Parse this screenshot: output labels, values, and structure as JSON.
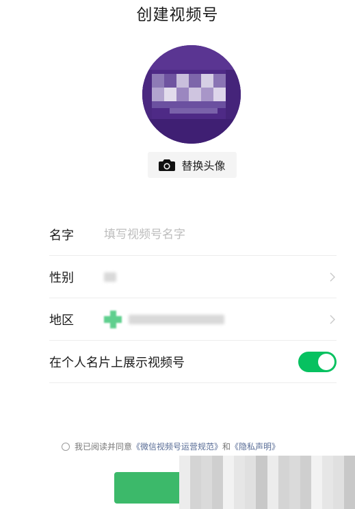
{
  "header": {
    "title": "创建视频号"
  },
  "avatar": {
    "change_label": "替换头像",
    "camera_icon": "camera-icon",
    "fill_color": "#4e2a86"
  },
  "form": {
    "name": {
      "label": "名字",
      "value": "",
      "placeholder": "填写视频号名字"
    },
    "gender": {
      "label": "性别"
    },
    "region": {
      "label": "地区"
    },
    "show_on_card": {
      "label": "在个人名片上展示视频号",
      "enabled": true
    }
  },
  "agreement": {
    "prefix": "我已阅读并同意",
    "operation_norms": "《微信视频号运营规范》",
    "conjunction": "和",
    "privacy": "《隐私声明》",
    "checked": false
  },
  "colors": {
    "accent": "#07c160",
    "button_green": "#3cb96a",
    "link_blue": "#576b95"
  }
}
